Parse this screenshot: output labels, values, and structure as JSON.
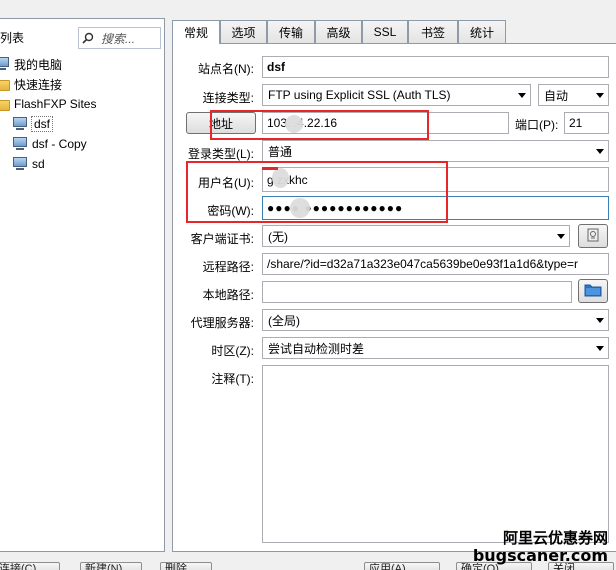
{
  "left_panel": {
    "title": "点列表",
    "search_placeholder": "搜索...",
    "tree": [
      {
        "label": "我的电脑",
        "icon": "computer-icon"
      },
      {
        "label": "快速连接",
        "icon": "folder-icon"
      },
      {
        "label": "FlashFXP Sites",
        "icon": "folder-icon"
      },
      {
        "label": "dsf",
        "icon": "site-icon",
        "selected": true
      },
      {
        "label": "dsf - Copy",
        "icon": "site-icon"
      },
      {
        "label": "sd",
        "icon": "site-icon"
      }
    ]
  },
  "tabs": [
    "常规",
    "选项",
    "传输",
    "高级",
    "SSL",
    "书签",
    "统计"
  ],
  "active_tab": "常规",
  "form": {
    "site_name_label": "站点名(N):",
    "site_name_value": "dsf",
    "conn_type_label": "连接类型:",
    "conn_type_value": "FTP using Explicit SSL (Auth TLS)",
    "conn_mode_value": "自动",
    "address_button": "地址",
    "address_value": "103.  .4.22.16",
    "port_label": "端口(P):",
    "port_value": "21",
    "login_type_label": "登录类型(L):",
    "login_type_value": "普通",
    "username_label": "用户名(U):",
    "username_value": "g    zxkhc",
    "password_label": "密码(W):",
    "password_value": "●●●●  ●●●●●●●●●●●●",
    "client_cert_label": "客户端证书:",
    "client_cert_value": "(无)",
    "remote_path_label": "远程路径:",
    "remote_path_value": "/share/?id=d32a71a323e047ca5639be0e93f1a1d6&type=r",
    "local_path_label": "本地路径:",
    "local_path_value": "",
    "proxy_label": "代理服务器:",
    "proxy_value": "(全局)",
    "timezone_label": "时区(Z):",
    "timezone_value": "尝试自动检测时差",
    "notes_label": "注释(T):",
    "notes_value": ""
  },
  "bottom_buttons": [
    "连接(C)",
    "新建(N)",
    "删除",
    "应用(A)",
    "确定(O)",
    "关闭"
  ],
  "watermark": {
    "line1": "阿里云优惠券网",
    "line2": "bugscaner.com"
  },
  "colors": {
    "annotation_red": "#e8262a",
    "border": "#8e9aa8",
    "folder_blue": "#2a72c3"
  }
}
